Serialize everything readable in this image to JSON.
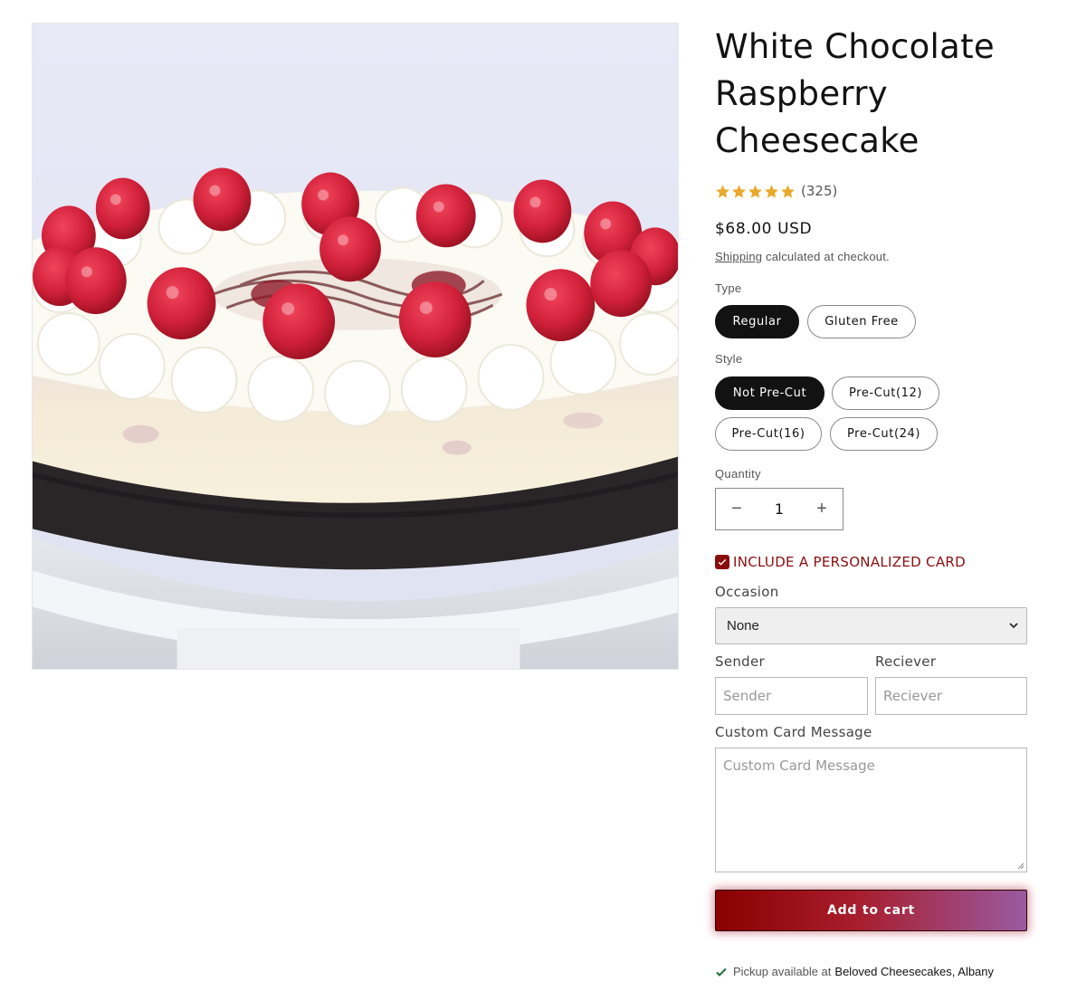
{
  "product": {
    "title": "White Chocolate Raspberry Cheesecake",
    "image_alt": "White chocolate raspberry cheesecake topped with whipped cream rosettes and fresh raspberries",
    "rating": {
      "stars": 5,
      "count": "(325)",
      "star_color": "#e9a92c"
    },
    "price": "$68.00 USD",
    "shipping": {
      "link": "Shipping",
      "text": " calculated at checkout."
    }
  },
  "options": {
    "type": {
      "label": "Type",
      "values": [
        "Regular",
        "Gluten Free"
      ],
      "selected": "Regular"
    },
    "style": {
      "label": "Style",
      "values": [
        "Not Pre-Cut",
        "Pre-Cut(12)",
        "Pre-Cut(16)",
        "Pre-Cut(24)"
      ],
      "selected": "Not Pre-Cut"
    }
  },
  "quantity": {
    "label": "Quantity",
    "value": "1",
    "minus": "−",
    "plus": "+"
  },
  "personalized_card": {
    "checkbox_label": "INCLUDE A PERSONALIZED CARD",
    "checked": true,
    "accent_color": "#8b0d0d",
    "occasion": {
      "label": "Occasion",
      "value": "None"
    },
    "sender": {
      "label": "Sender",
      "placeholder": "Sender"
    },
    "receiver": {
      "label": "Reciever",
      "placeholder": "Reciever"
    },
    "message": {
      "label": "Custom Card Message",
      "placeholder": "Custom Card Message"
    }
  },
  "cart": {
    "button_label": "Add to cart"
  },
  "pickup": {
    "text": "Pickup available at",
    "location": "Beloved Cheesecakes, Albany"
  }
}
